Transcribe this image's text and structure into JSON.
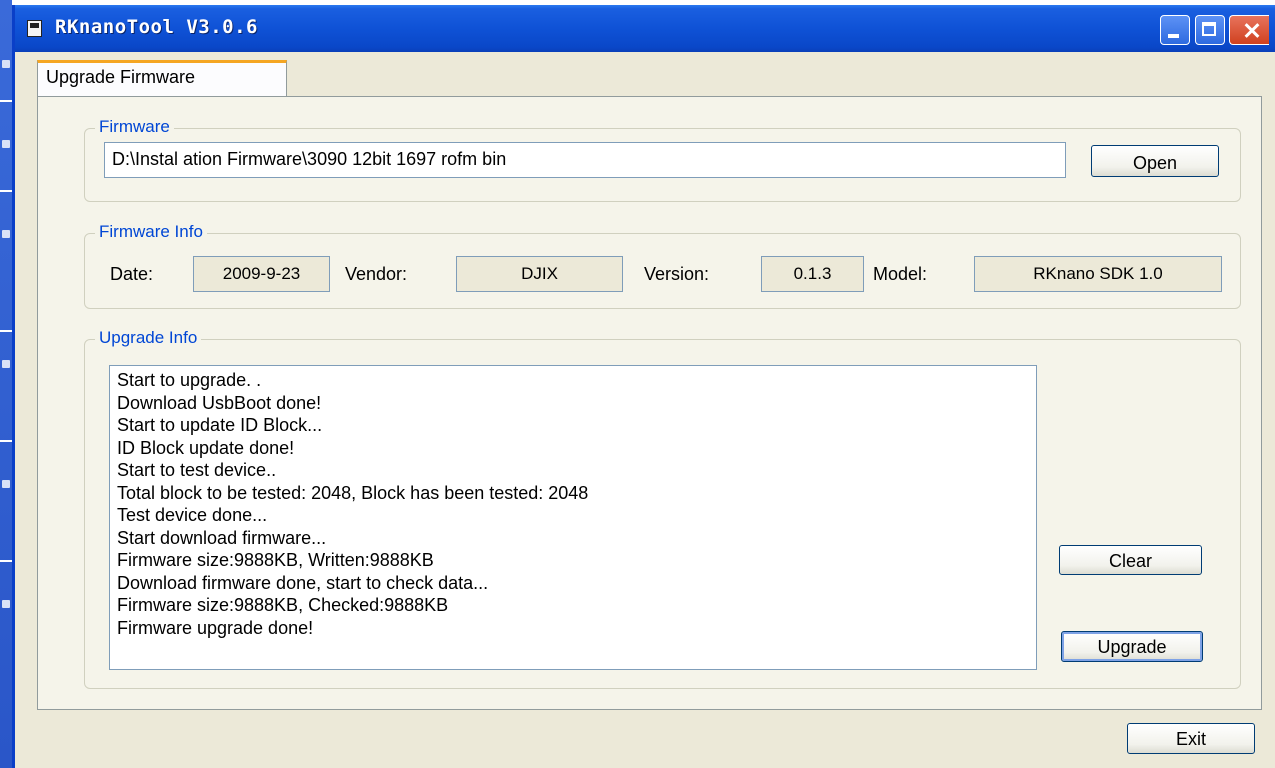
{
  "window": {
    "title": "RKnanoTool V3.0.6"
  },
  "tabs": [
    {
      "label": "Upgrade Firmware",
      "active": true
    }
  ],
  "firmware": {
    "group_title": "Firmware",
    "path": "D:\\Instal ation Firmware\\3090  12bit  1697  rofm bin",
    "open_label": "Open"
  },
  "firmware_info": {
    "group_title": "Firmware Info",
    "date_label": "Date:",
    "date_value": "2009-9-23",
    "vendor_label": "Vendor:",
    "vendor_value": "DJIX",
    "version_label": "Version:",
    "version_value": "0.1.3",
    "model_label": "Model:",
    "model_value": "RKnano SDK 1.0"
  },
  "upgrade_info": {
    "group_title": "Upgrade Info",
    "log_lines": [
      "Start to upgrade. .",
      "Download UsbBoot done!",
      "Start to update ID Block...",
      "ID Block update done!",
      "Start to test device..",
      "Total  block to be tested: 2048, Block has been tested: 2048",
      "Test device done...",
      "Start download firmware...",
      "Firmware size:9888KB, Written:9888KB",
      "Download firmware done, start to check data...",
      "Firmware size:9888KB, Checked:9888KB",
      "Firmware upgrade done!"
    ],
    "clear_label": "Clear",
    "upgrade_label": "Upgrade"
  },
  "footer": {
    "exit_label": "Exit"
  },
  "colors": {
    "titlebar": "#0a47c8",
    "window_bg": "#ece9d8",
    "group_title": "#0046d5",
    "tab_highlight": "#f5a623"
  }
}
